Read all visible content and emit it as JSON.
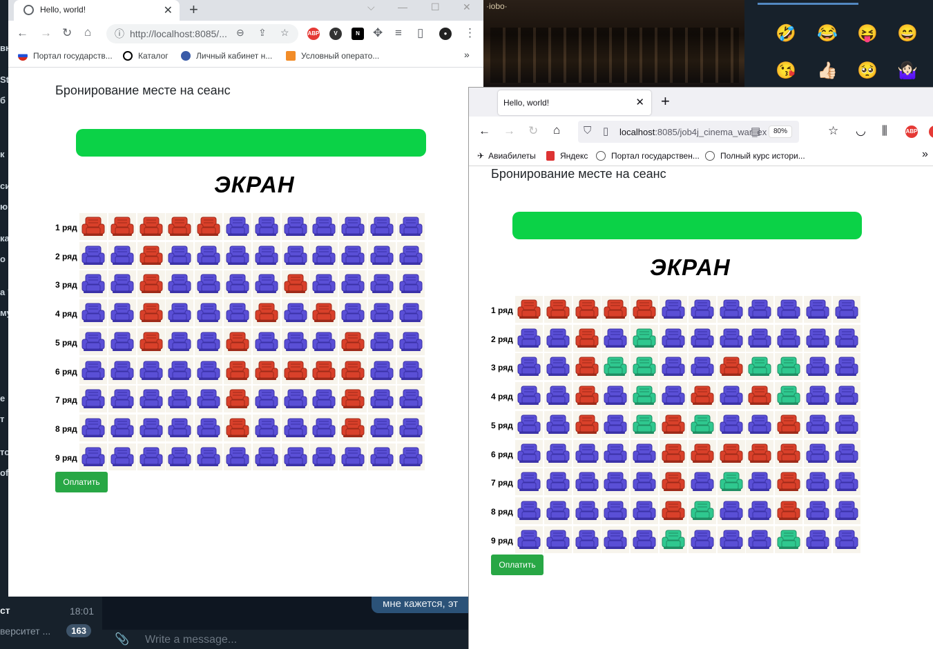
{
  "telegram": {
    "chat_time": "18:01",
    "chat_preview": "верситет ...",
    "unread_count": "163",
    "bubble_text": "мне кажется, эт",
    "compose_placeholder": "Write a message...",
    "left_cut_letters": [
      "вн",
      "St",
      "б",
      "к",
      "си",
      "ю",
      "ка",
      "о",
      "а \"",
      "му",
      "е",
      "т",
      "то",
      "of"
    ]
  },
  "video_label": "·iobo·",
  "emojis": [
    "🤣",
    "😂",
    "😝",
    "😄",
    "😘",
    "👍🏻",
    "🥺",
    "🤷🏻‍♀️"
  ],
  "chrome": {
    "tab_title": "Hello, world!",
    "url": "http://localhost:8085/...",
    "bookmarks": [
      "Портал государств...",
      "Каталог",
      "Личный кабинет н...",
      "Условный операто..."
    ],
    "more": "»"
  },
  "firefox": {
    "tab_title": "Hello, world!",
    "url_host": "localhost",
    "url_rest": ":8085/job4j_cinema_war_ex",
    "zoom": "80%",
    "bookmarks": [
      "Авиабилеты",
      "Яндекс",
      "Портал государствен...",
      "Полный курс истори..."
    ],
    "more": "»"
  },
  "page": {
    "heading": "Бронирование месте на сеанс",
    "screen_label": "ЭКРАН",
    "pay_button": "Оплатить",
    "row_suffix": "ряд"
  },
  "colors": {
    "free": "#5a4fd6",
    "taken": "#d9402a",
    "selected": "#2fc88f",
    "screen_bar": "#0bd247",
    "pay": "#28a745"
  },
  "hall_chrome": {
    "rows": [
      {
        "label": "1 ряд",
        "seats": [
          "taken",
          "taken",
          "taken",
          "taken",
          "taken",
          "free",
          "free",
          "free",
          "free",
          "free",
          "free",
          "free"
        ]
      },
      {
        "label": "2 ряд",
        "seats": [
          "free",
          "free",
          "taken",
          "free",
          "free",
          "free",
          "free",
          "free",
          "free",
          "free",
          "free",
          "free"
        ]
      },
      {
        "label": "3 ряд",
        "seats": [
          "free",
          "free",
          "taken",
          "free",
          "free",
          "free",
          "free",
          "taken",
          "free",
          "free",
          "free",
          "free"
        ]
      },
      {
        "label": "4 ряд",
        "seats": [
          "free",
          "free",
          "taken",
          "free",
          "free",
          "free",
          "taken",
          "free",
          "taken",
          "free",
          "free",
          "free"
        ]
      },
      {
        "label": "5 ряд",
        "seats": [
          "free",
          "free",
          "taken",
          "free",
          "free",
          "taken",
          "free",
          "free",
          "free",
          "taken",
          "free",
          "free"
        ]
      },
      {
        "label": "6 ряд",
        "seats": [
          "free",
          "free",
          "free",
          "free",
          "free",
          "taken",
          "taken",
          "taken",
          "taken",
          "taken",
          "free",
          "free"
        ]
      },
      {
        "label": "7 ряд",
        "seats": [
          "free",
          "free",
          "free",
          "free",
          "free",
          "taken",
          "free",
          "free",
          "free",
          "taken",
          "free",
          "free"
        ]
      },
      {
        "label": "8 ряд",
        "seats": [
          "free",
          "free",
          "free",
          "free",
          "free",
          "taken",
          "free",
          "free",
          "free",
          "taken",
          "free",
          "free"
        ]
      },
      {
        "label": "9 ряд",
        "seats": [
          "free",
          "free",
          "free",
          "free",
          "free",
          "free",
          "free",
          "free",
          "free",
          "free",
          "free",
          "free"
        ]
      }
    ]
  },
  "hall_firefox": {
    "rows": [
      {
        "label": "1 ряд",
        "seats": [
          "taken",
          "taken",
          "taken",
          "taken",
          "taken",
          "free",
          "free",
          "free",
          "free",
          "free",
          "free",
          "free"
        ]
      },
      {
        "label": "2 ряд",
        "seats": [
          "free",
          "free",
          "taken",
          "free",
          "selected",
          "free",
          "free",
          "free",
          "free",
          "free",
          "free",
          "free"
        ]
      },
      {
        "label": "3 ряд",
        "seats": [
          "free",
          "free",
          "taken",
          "selected",
          "selected",
          "free",
          "free",
          "taken",
          "selected",
          "selected",
          "free",
          "free"
        ]
      },
      {
        "label": "4 ряд",
        "seats": [
          "free",
          "free",
          "taken",
          "free",
          "selected",
          "free",
          "taken",
          "free",
          "taken",
          "selected",
          "free",
          "free"
        ]
      },
      {
        "label": "5 ряд",
        "seats": [
          "free",
          "free",
          "taken",
          "free",
          "selected",
          "taken",
          "selected",
          "free",
          "free",
          "taken",
          "free",
          "free"
        ]
      },
      {
        "label": "6 ряд",
        "seats": [
          "free",
          "free",
          "free",
          "free",
          "free",
          "taken",
          "taken",
          "taken",
          "taken",
          "taken",
          "free",
          "free"
        ]
      },
      {
        "label": "7 ряд",
        "seats": [
          "free",
          "free",
          "free",
          "free",
          "free",
          "taken",
          "free",
          "selected",
          "free",
          "taken",
          "free",
          "free"
        ]
      },
      {
        "label": "8 ряд",
        "seats": [
          "free",
          "free",
          "free",
          "free",
          "free",
          "taken",
          "selected",
          "free",
          "free",
          "taken",
          "free",
          "free"
        ]
      },
      {
        "label": "9 ряд",
        "seats": [
          "free",
          "free",
          "free",
          "free",
          "free",
          "selected",
          "free",
          "free",
          "free",
          "selected",
          "free",
          "free"
        ]
      }
    ]
  }
}
